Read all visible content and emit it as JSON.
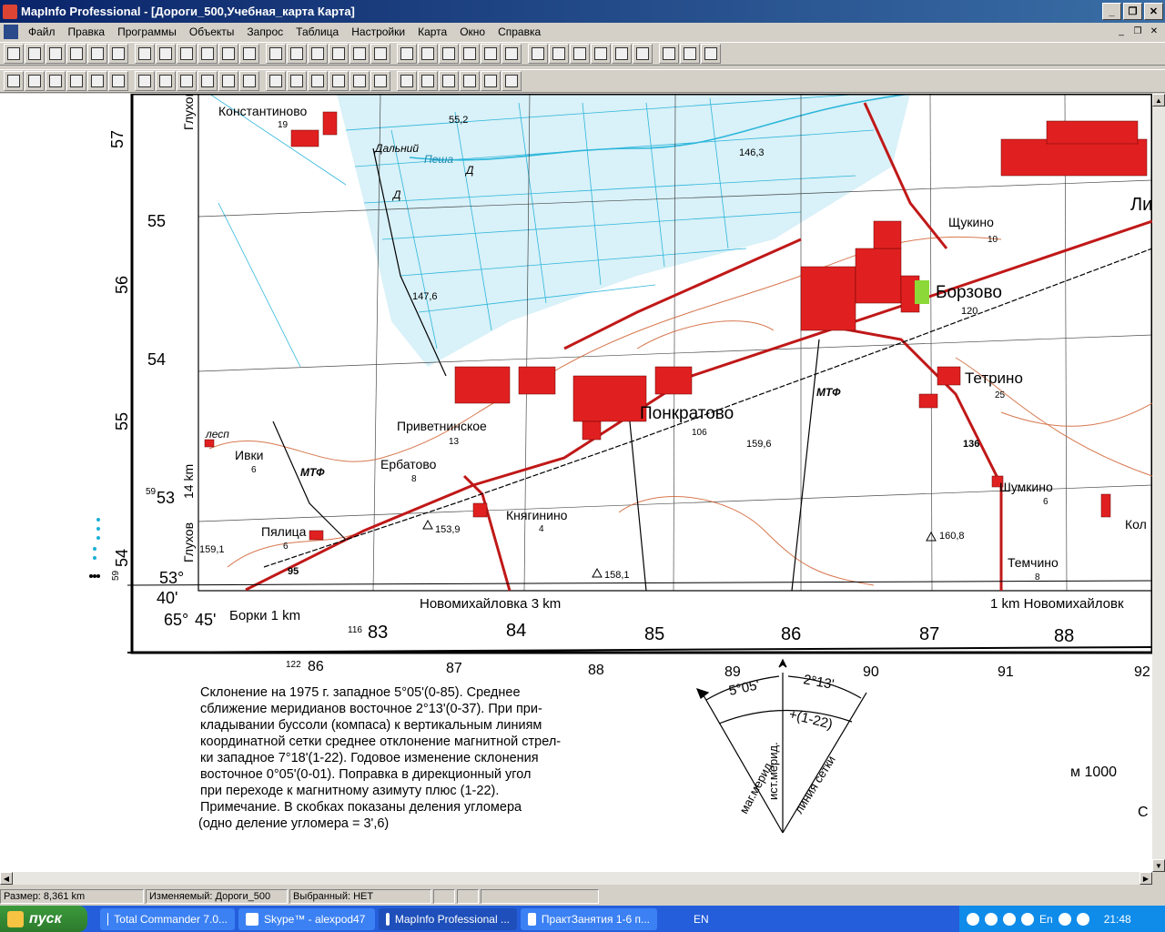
{
  "window": {
    "title": "MapInfo Professional - [Дороги_500,Учебная_карта Карта]",
    "controls": [
      "_",
      "❐",
      "✕"
    ]
  },
  "menu": {
    "items": [
      "Файл",
      "Правка",
      "Программы",
      "Объекты",
      "Запрос",
      "Таблица",
      "Настройки",
      "Карта",
      "Окно",
      "Справка"
    ],
    "mdi_controls": [
      "_",
      "❐",
      "✕"
    ]
  },
  "toolbar1": {
    "icons": [
      "new-icon",
      "open-icon",
      "table-icon",
      "workspace-icon",
      "save-icon",
      "print-icon",
      "cut-icon",
      "copy-icon",
      "paste-icon",
      "undo-icon",
      "browser-icon",
      "map-icon",
      "graph-icon",
      "layout-icon",
      "help-icon",
      "symbol-icon",
      "line-icon",
      "polyline-icon",
      "arc-icon",
      "polygon-icon",
      "ellipse-icon",
      "rectangle-icon",
      "rounded-rect-icon",
      "text-icon",
      "frame-icon",
      "reshape-icon",
      "add-node-icon",
      "symbol-style-icon",
      "line-style-icon",
      "region-style-icon",
      "text-style-icon",
      "runner-icon",
      "tool-icon"
    ]
  },
  "toolbar2": {
    "icons": [
      "select-icon",
      "marquee-icon",
      "radius-icon",
      "polygon-select-icon",
      "boundary-icon",
      "unselect-icon",
      "invert-icon",
      "graph-select-icon",
      "zoom-in-icon",
      "zoom-out-icon",
      "change-view-icon",
      "grabber-icon",
      "info-icon",
      "ruler-icon",
      "label-icon",
      "drag-window-icon",
      "layer-control-icon",
      "scale-icon",
      "legend-icon",
      "statistics-icon",
      "clip-icon",
      "set-clip-icon",
      "hotlink-icon",
      "report-icon"
    ]
  },
  "map": {
    "towns": [
      {
        "name": "Константиново",
        "pop": "19"
      },
      {
        "name": "Щукино",
        "pop": "10"
      },
      {
        "name": "Борзово",
        "pop": ""
      },
      {
        "name": "Тетрино",
        "pop": "25"
      },
      {
        "name": "Понкратово",
        "pop": "106"
      },
      {
        "name": "Приветнинское",
        "pop": "13"
      },
      {
        "name": "Ербатово",
        "pop": "8"
      },
      {
        "name": "Княгинино",
        "pop": "4"
      },
      {
        "name": "Ивки",
        "pop": "6"
      },
      {
        "name": "Пялица",
        "pop": "6"
      },
      {
        "name": "Шумкино",
        "pop": "6"
      },
      {
        "name": "Темчино",
        "pop": "8"
      },
      {
        "name": "Кол",
        "pop": ""
      },
      {
        "name": "Ли",
        "pop": ""
      }
    ],
    "labels": [
      "Дальний",
      "Пеша",
      "МТФ",
      "МТФ",
      "лесп",
      "Д",
      "Д"
    ],
    "spot_heights": [
      "55,2",
      "146,3",
      "147,6",
      "159,6",
      "153,9",
      "158,1",
      "159,1",
      "160,8",
      "120"
    ],
    "road_numbers": [
      "95",
      "136"
    ],
    "grid_y_labels": [
      "57",
      "55",
      "56",
      "54",
      "55",
      "53",
      "54",
      "53°",
      "40'"
    ],
    "grid_x_labels": [
      "83",
      "84",
      "85",
      "86",
      "87",
      "88"
    ],
    "outer_x_labels": [
      "86",
      "87",
      "88",
      "89",
      "90",
      "91",
      "92"
    ],
    "outer_x_small": [
      "116",
      "122"
    ],
    "left_side": {
      "glukhov": "Глухов",
      "km": "14 km",
      "glukhov2": "Глухов",
      "n59a": "59",
      "n59b": "59"
    },
    "corner": {
      "lon": "65°",
      "min": "45'"
    },
    "destinations": [
      {
        "text": "Борки 1 km"
      },
      {
        "text": "Новомихайловка 3 km"
      },
      {
        "text": "1 km Новомихайловк"
      }
    ],
    "declination_text": [
      "Склонение на 1975 г. западное  5°05'(0-85).  Среднее",
      "сближение меридианов восточное 2°13'(0-37). При при-",
      "кладывании буссоли (компаса)  к вертикальным  линиям",
      "координатной сетки среднее отклонение магнитной стрел-",
      "ки западное 7°18'(1-22).  Годовое изменение склонения",
      "восточное 0°05'(0-01). Поправка в дирекционный угол",
      "при переходе к магнитному азимуту плюс  (1-22).",
      "Примечание. В скобках показаны   деления угломера",
      "(одно деление  угломера = 3',6)"
    ],
    "diagram": {
      "angle_west": "5°05'",
      "angle_east": "2°13'",
      "correction": "+(1-22)",
      "mag_meridian": "маг.мерид.",
      "true_meridian": "ист.мерид.",
      "grid_line": "линия сетки"
    },
    "scale_label": "м 1000",
    "edge_letter": "С"
  },
  "status": {
    "size": "Размер: 8,361 km",
    "editable": "Изменяемый: Дороги_500",
    "selected": "Выбранный: НЕТ"
  },
  "taskbar": {
    "start": "пуск",
    "tasks": [
      "Total Commander 7.0...",
      "Skype™ - alexpod47",
      "MapInfo Professional ...",
      "ПрактЗанятия 1-6  п..."
    ],
    "lang": "EN",
    "tray_lang": "En",
    "clock": "21:48"
  },
  "colors": {
    "title_start": "#0a246a",
    "title_end": "#3a6ea5",
    "map_red": "#e02020",
    "map_cyan": "#1ab0d8",
    "map_brown": "#d06030",
    "taskbar": "#245edb"
  }
}
